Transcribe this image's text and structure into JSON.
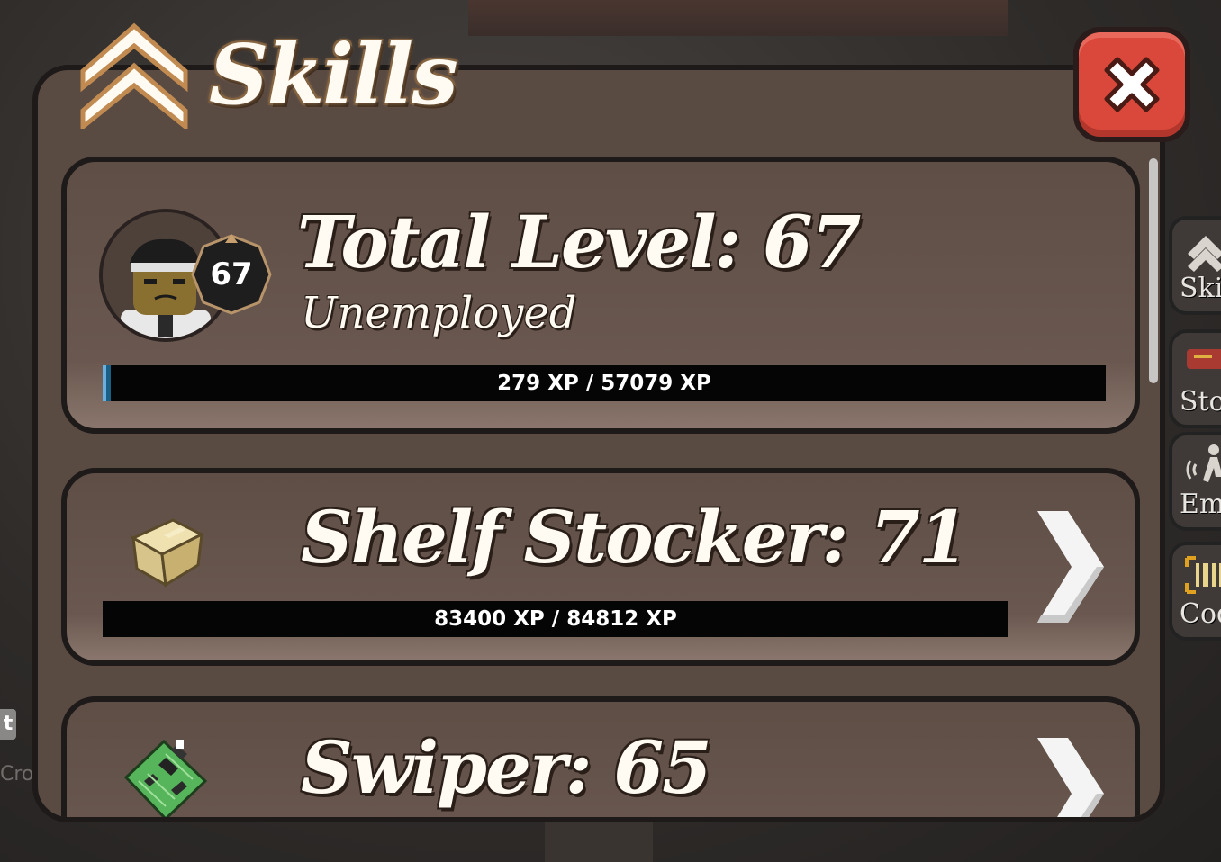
{
  "window": {
    "title": "Skills",
    "close_label": "Close"
  },
  "total": {
    "title": "Total Level: 67",
    "level_badge": "67",
    "job": "Unemployed",
    "xp_text": "279 XP / 57079 XP",
    "xp_current": 279,
    "xp_max": 57079
  },
  "skills": [
    {
      "title": "Shelf Stocker: 71",
      "icon": "cardboard-box-icon",
      "xp_text": "83400 XP / 84812 XP",
      "xp_current": 83400,
      "xp_max": 84812
    },
    {
      "title": "Swiper: 65",
      "icon": "circuit-board-icon"
    }
  ],
  "side_menu": [
    {
      "label": "Ski",
      "icon": "chevron-up-icon"
    },
    {
      "label": "Sto",
      "icon": "store-icon"
    },
    {
      "label": "Emo",
      "icon": "emote-icon"
    },
    {
      "label": "Cod",
      "icon": "barcode-icon"
    }
  ],
  "background": {
    "left_tag": "t",
    "left_text": "Cro"
  },
  "colors": {
    "panel": "#594a42",
    "card": "#6a5850",
    "close_button": "#d9483a",
    "xp_bar": "#050505",
    "xp_fill": "#1a5f86"
  }
}
